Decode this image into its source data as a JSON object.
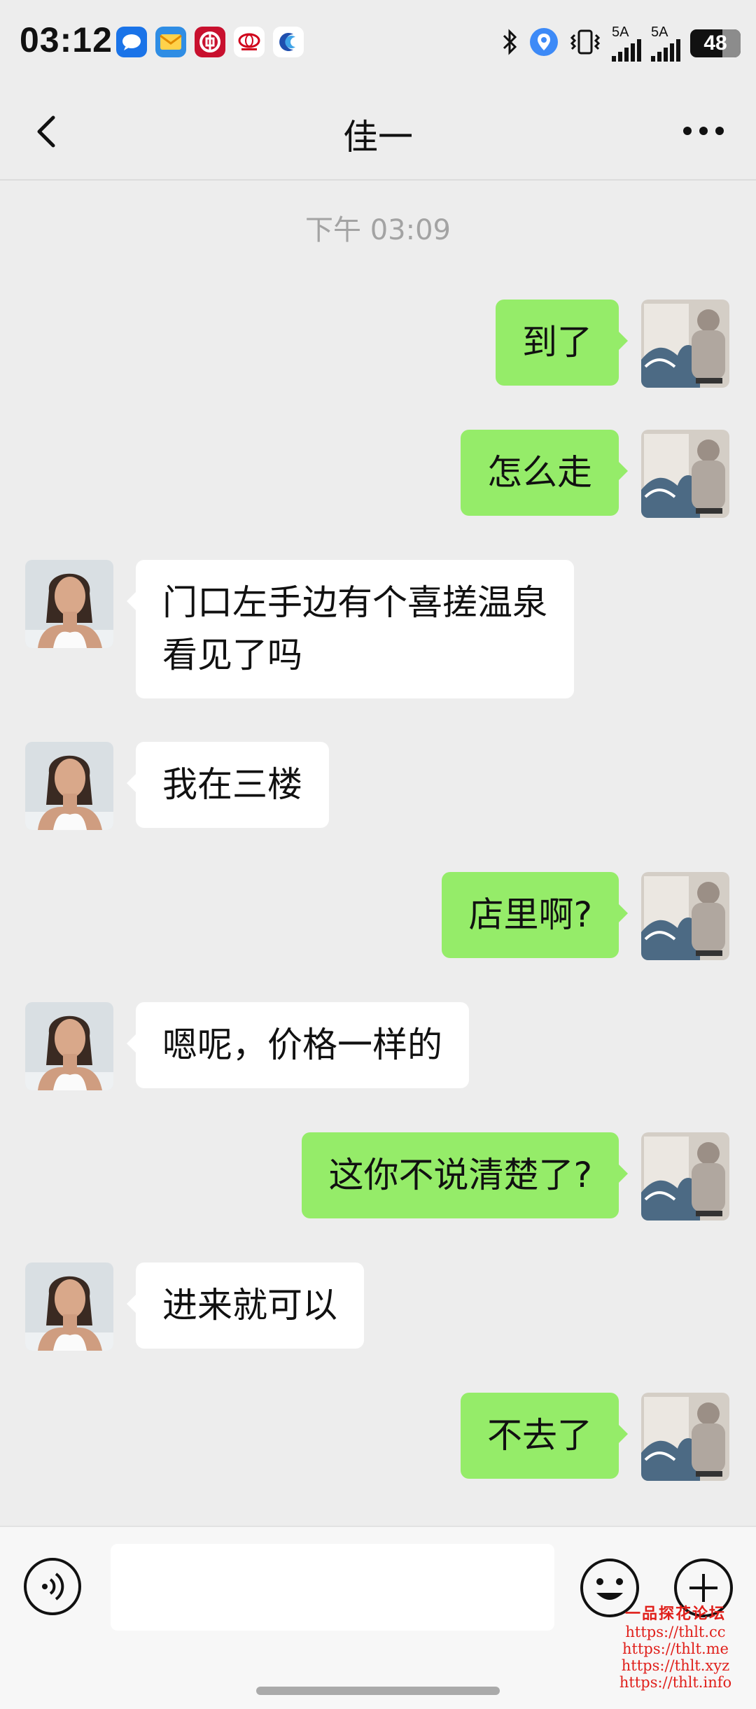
{
  "status_bar": {
    "time": "03:12",
    "app_icons": [
      {
        "name": "messages-app-icon",
        "color": "#1a73e8"
      },
      {
        "name": "mail-app-icon",
        "color": "#2f8de4"
      },
      {
        "name": "bank-of-china-app-icon",
        "color": "#c8102e"
      },
      {
        "name": "toyota-app-icon",
        "color": "#ffffff"
      },
      {
        "name": "moon-app-icon",
        "color": "#ffffff"
      }
    ],
    "network_1": "5A",
    "network_2": "5A",
    "battery": "48",
    "battery_level": 0.48
  },
  "header": {
    "title": "佳一"
  },
  "conversation": {
    "timestamp": "下午 03:09",
    "messages": [
      {
        "side": "out",
        "text": "到了"
      },
      {
        "side": "out",
        "text": "怎么走"
      },
      {
        "side": "in",
        "text": "门口左手边有个喜搓温泉\n看见了吗"
      },
      {
        "side": "in",
        "text": "我在三楼"
      },
      {
        "side": "out",
        "text": "店里啊?"
      },
      {
        "side": "in",
        "text": "嗯呢，价格一样的"
      },
      {
        "side": "out",
        "text": "这你不说清楚了?"
      },
      {
        "side": "in",
        "text": "进来就可以"
      },
      {
        "side": "out",
        "text": "不去了"
      }
    ]
  },
  "input_bar": {
    "message_value": ""
  },
  "watermark": {
    "title": "一品探花论坛",
    "links": [
      "https://thlt.cc",
      "https://thlt.me",
      "https://thlt.xyz",
      "https://thlt.info"
    ]
  }
}
